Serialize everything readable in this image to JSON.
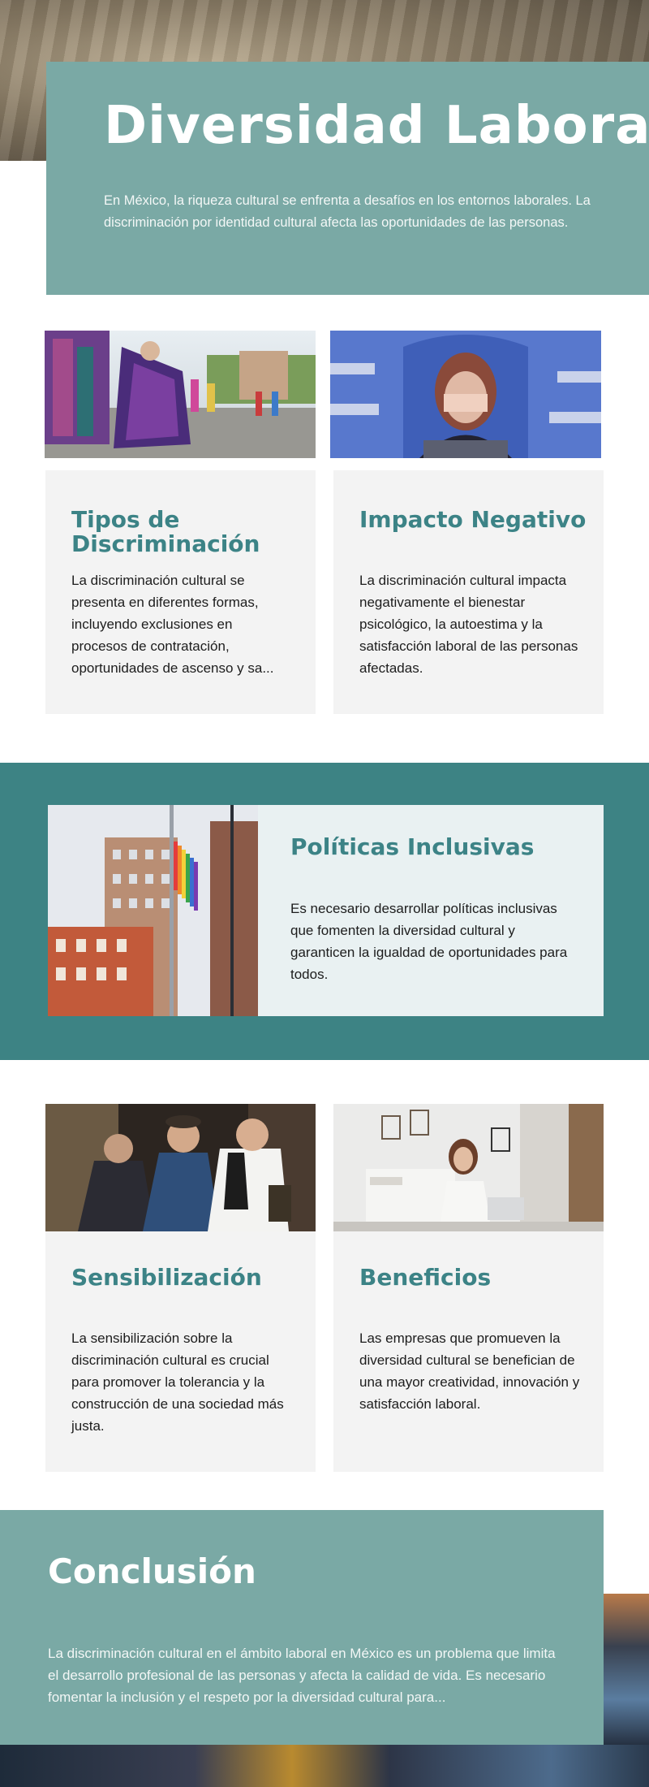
{
  "hero": {
    "title": "Diversidad Laboral",
    "text": "En México, la riqueza cultural se enfrenta a desafíos en los entornos laborales. La discriminación por identidad cultural afecta las oportunidades de las personas."
  },
  "cards_top": [
    {
      "title": "Tipos de Discriminación",
      "text": "La discriminación cultural se presenta en diferentes formas, incluyendo exclusiones en procesos de contratación, oportunidades de ascenso y sa..."
    },
    {
      "title": "Impacto Negativo",
      "text": "La discriminación cultural impacta negativamente el bienestar psicológico, la autoestima y la satisfacción laboral de las personas afectadas."
    }
  ],
  "policies": {
    "title": "Políticas Inclusivas",
    "text": "Es necesario desarrollar políticas inclusivas que fomenten la diversidad cultural y garanticen la igualdad de oportunidades para todos."
  },
  "cards_bottom": [
    {
      "title": "Sensibilización",
      "text": "La sensibilización sobre la discriminación cultural es crucial para promover la tolerancia y la construcción de una sociedad más justa."
    },
    {
      "title": "Beneficios",
      "text": "Las empresas que promueven la diversidad cultural se benefician de una mayor creatividad, innovación y satisfacción laboral."
    }
  ],
  "conclusion": {
    "title": "Conclusión",
    "text": "La discriminación cultural en el ámbito laboral en México es un problema que limita el desarrollo profesional de las personas y afecta la calidad de vida. Es necesario fomentar la inclusión y el respeto por la diversidad cultural para..."
  },
  "colors": {
    "accent": "#7aa9a5",
    "band": "#3d8384",
    "heading": "#3c8386",
    "card_bg": "#f3f3f3"
  }
}
